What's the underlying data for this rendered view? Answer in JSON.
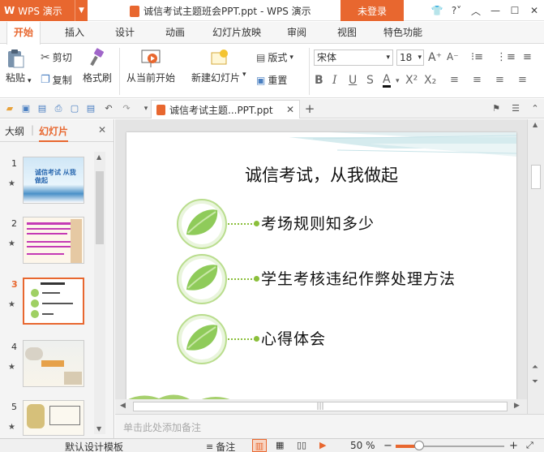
{
  "app": {
    "logo": "W",
    "name": "WPS 演示",
    "document_title": "诚信考试主题班会PPT.ppt - WPS 演示",
    "login_label": "未登录"
  },
  "menu": {
    "tabs": [
      "开始",
      "插入",
      "设计",
      "动画",
      "幻灯片放映",
      "审阅",
      "视图",
      "特色功能"
    ],
    "active_index": 0
  },
  "ribbon": {
    "paste": "粘贴",
    "cut": "剪切",
    "copy": "复制",
    "format_painter": "格式刷",
    "from_current": "从当前开始",
    "new_slide": "新建幻灯片",
    "layout": "版式",
    "reset": "重置",
    "font_name": "宋体",
    "font_size": "18"
  },
  "doc_tab": {
    "label": "诚信考试主题...PPT.ppt"
  },
  "left_panel": {
    "tab_outline": "大纲",
    "tab_slides": "幻灯片",
    "active_slide": 3,
    "thumbnails": [
      {
        "number": "1",
        "caption": "诚信考试 从我做起"
      },
      {
        "number": "2",
        "caption": ""
      },
      {
        "number": "3",
        "caption": ""
      },
      {
        "number": "4",
        "caption": ""
      },
      {
        "number": "5",
        "caption": ""
      }
    ]
  },
  "slide": {
    "title": "诚信考试，从我做起",
    "bullets": [
      "考场规则知多少",
      "学生考核违纪作弊处理方法",
      "心得体会"
    ]
  },
  "notes_placeholder": "单击此处添加备注",
  "status": {
    "template": "默认设计模板",
    "notes": "备注",
    "zoom_label": "50 %",
    "zoom_fraction": 0.22
  },
  "colors": {
    "accent": "#e8672f",
    "leaf_green": "#8bbf3b"
  }
}
